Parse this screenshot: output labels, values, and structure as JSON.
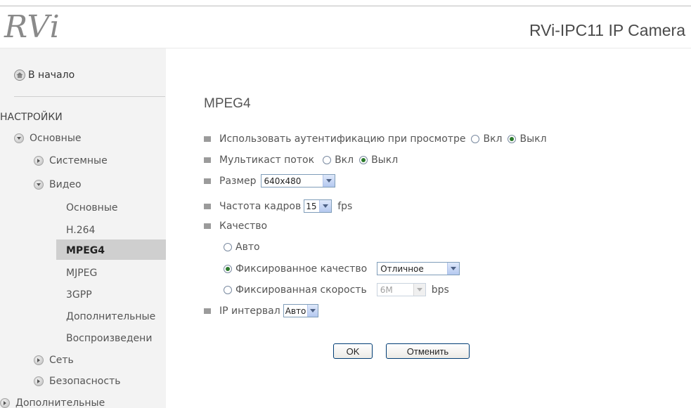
{
  "header": {
    "logo_text": "RVi",
    "product_title": "RVi-IPC11 IP Camera"
  },
  "sidebar": {
    "home_label": "В начало",
    "section_title": "НАСТРОЙКИ",
    "basic": "Основные",
    "system": "Системные",
    "video": "Видео",
    "video_items": [
      "Основные",
      "H.264",
      "MPEG4",
      "MJPEG",
      "3GPP",
      "Дополнительные",
      "Воспроизведени"
    ],
    "network": "Сеть",
    "security": "Безопасность",
    "advanced": "Дополнительные"
  },
  "main": {
    "title": "MPEG4",
    "auth": {
      "label": "Использовать аутентификацию при просмотре",
      "on": "Вкл",
      "off": "Выкл",
      "selected": "off"
    },
    "multicast": {
      "label": "Мультикаст поток",
      "on": "Вкл",
      "off": "Выкл",
      "selected": "off"
    },
    "size": {
      "label": "Размер",
      "value": "640x480"
    },
    "fps": {
      "label": "Частота кадров",
      "value": "15",
      "unit": "fps"
    },
    "quality": {
      "label": "Качество",
      "auto": "Авто",
      "fixed_quality": "Фиксированное качество",
      "fixed_quality_value": "Отличное",
      "fixed_rate": "Фиксированная скорость",
      "fixed_rate_value": "6M",
      "fixed_rate_unit": "bps",
      "selected": "fixed_quality"
    },
    "ip_interval": {
      "label": "IP интервал",
      "value": "Авто"
    },
    "ok_label": "OK",
    "cancel_label": "Отменить"
  },
  "colors": {
    "active_bg": "#cfcfcf",
    "sidebar_bg": "#f3f3f3",
    "radio_dot": "#2b7a2b"
  }
}
